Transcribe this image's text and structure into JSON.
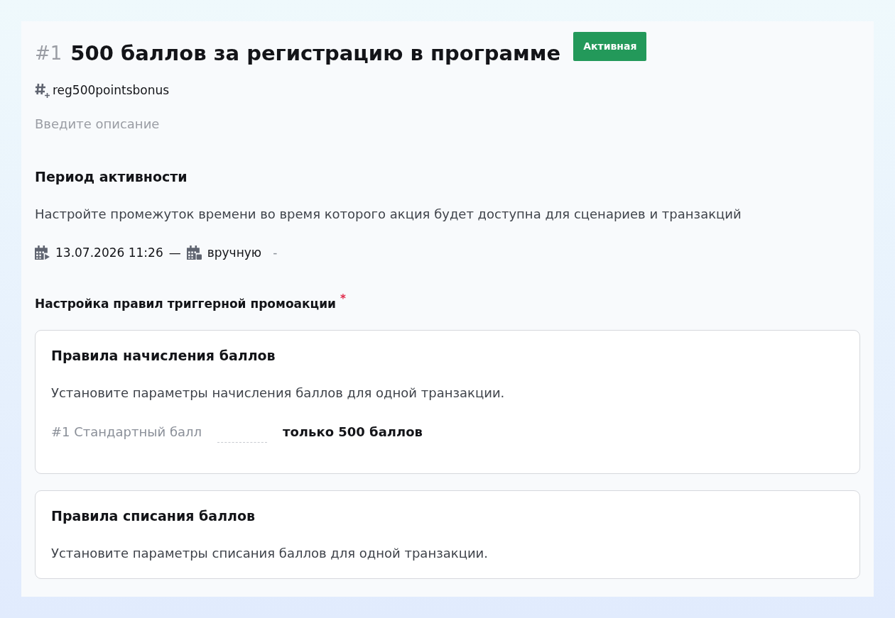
{
  "promo": {
    "number": "#1",
    "title": "500 баллов за регистрацию в программе",
    "status": {
      "label": "Активная",
      "kind": "active"
    },
    "code": "reg500pointsbonus",
    "description": {
      "placeholder": "Введите описание"
    }
  },
  "activity_period": {
    "heading": "Период активности",
    "hint": "Настройте промежуток времени во время которого акция будет доступна для сценариев и транзакций",
    "start": "13.07.2026 11:26",
    "dash": "—",
    "end": "вручную",
    "trailing": "-"
  },
  "trigger_rules": {
    "heading": "Настройка правил триггерной промоакции",
    "required_mark": "*",
    "cards": [
      {
        "title": "Правила начисления баллов",
        "hint": "Установите параметры начисления баллов для одной транзакции.",
        "rules": [
          {
            "name": "#1 Стандартный балл",
            "value": "только 500 баллов"
          }
        ]
      },
      {
        "title": "Правила списания баллов",
        "hint": "Установите параметры списания баллов для одной транзакции."
      }
    ]
  }
}
